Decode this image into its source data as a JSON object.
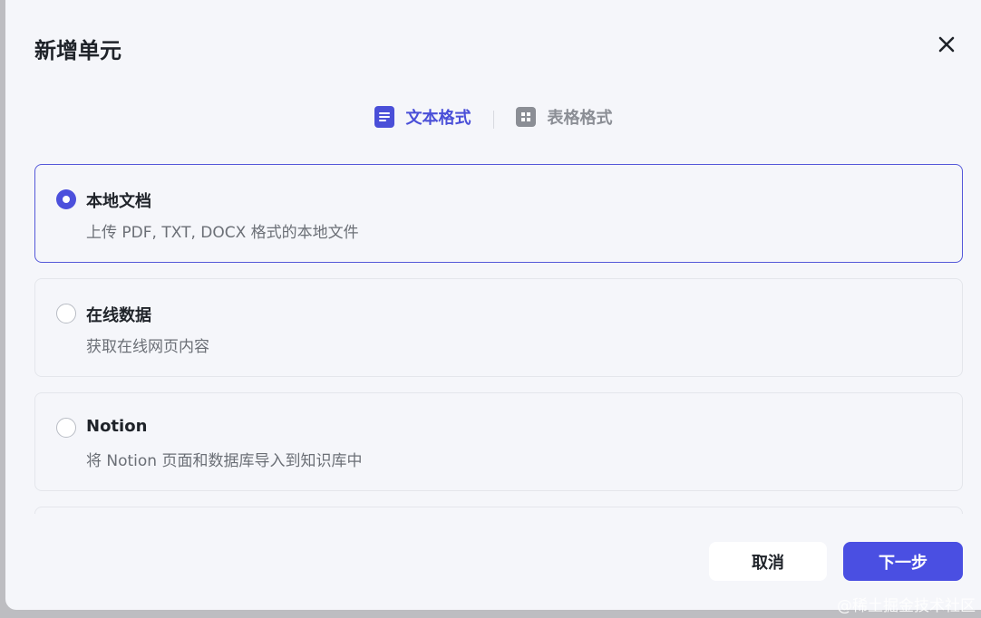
{
  "dialog": {
    "title": "新增单元"
  },
  "tabs": [
    {
      "label": "文本格式",
      "active": true,
      "icon": "document-icon"
    },
    {
      "label": "表格格式",
      "active": false,
      "icon": "table-icon"
    }
  ],
  "options": [
    {
      "title": "本地文档",
      "description": "上传 PDF, TXT, DOCX 格式的本地文件",
      "selected": true
    },
    {
      "title": "在线数据",
      "description": "获取在线网页内容",
      "selected": false
    },
    {
      "title": "Notion",
      "description": "将 Notion 页面和数据库导入到知识库中",
      "selected": false
    }
  ],
  "footer": {
    "cancel_label": "取消",
    "next_label": "下一步"
  },
  "watermark": "@稀土掘金技术社区",
  "colors": {
    "accent": "#4a4fe2",
    "background": "#f5f6fa",
    "text": "#1f2329",
    "muted": "#6b6f76"
  }
}
